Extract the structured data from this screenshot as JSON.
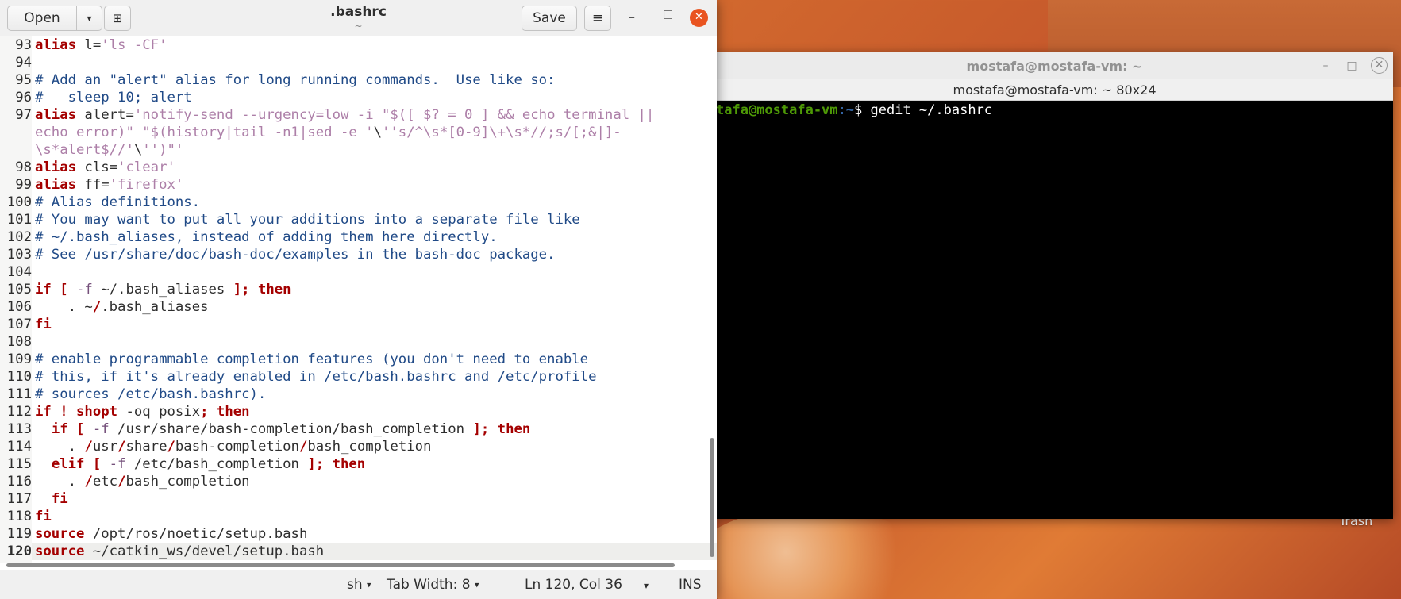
{
  "desktop": {
    "trash_label": "Trash"
  },
  "terminal": {
    "title": "mostafa@mostafa-vm: ~",
    "size_label": "mostafa@mostafa-vm: ~ 80x24",
    "prompt_user": "tafa@mostafa-vm",
    "prompt_path": ":~",
    "prompt_symbol": "$ ",
    "command": "gedit ~/.bashrc",
    "controls": {
      "minimize": "–",
      "maximize": "□",
      "close": "✕"
    }
  },
  "gedit": {
    "open_label": "Open",
    "open_arrow": "▾",
    "new_tab_icon": "⊞",
    "save_label": "Save",
    "menu_icon": "≡",
    "title": ".bashrc",
    "subtitle": "~",
    "controls": {
      "minimize": "–",
      "maximize": "□",
      "close": "✕"
    },
    "status": {
      "language": "sh",
      "tab_width": "Tab Width: 8",
      "position": "Ln 120, Col 36",
      "mode": "INS"
    },
    "lines": [
      {
        "n": "93",
        "html": "<span class=\"kw\">alias</span> l=<span class=\"str\">'ls -CF'</span>"
      },
      {
        "n": "94",
        "html": ""
      },
      {
        "n": "95",
        "html": "<span class=\"cm\"># Add an \"alert\" alias for long running commands.  Use like so:</span>"
      },
      {
        "n": "96",
        "html": "<span class=\"cm\">#   sleep 10; alert</span>"
      },
      {
        "n": "97",
        "html": "<span class=\"kw\">alias</span> alert=<span class=\"str\">'notify-send --urgency=low -i \"$([ $? = 0 ] &amp;&amp; echo terminal ||</span>"
      },
      {
        "n": "",
        "html": "<span class=\"str\">echo error)\" \"$(history|tail -n1|sed -e '</span>\\<span class=\"str\">''s/^\\s*[0-9]\\+\\s*//;s/[;&amp;|]-</span>"
      },
      {
        "n": "",
        "html": "<span class=\"str\">\\s*alert$//'</span>\\<span class=\"str\">'')\"'</span>"
      },
      {
        "n": "98",
        "html": "<span class=\"kw\">alias</span> cls=<span class=\"str\">'clear'</span>"
      },
      {
        "n": "99",
        "html": "<span class=\"kw\">alias</span> ff=<span class=\"str\">'firefox'</span>"
      },
      {
        "n": "100",
        "html": "<span class=\"cm\"># Alias definitions.</span>"
      },
      {
        "n": "101",
        "html": "<span class=\"cm\"># You may want to put all your additions into a separate file like</span>"
      },
      {
        "n": "102",
        "html": "<span class=\"cm\"># ~/.bash_aliases, instead of adding them here directly.</span>"
      },
      {
        "n": "103",
        "html": "<span class=\"cm\"># See /usr/share/doc/bash-doc/examples in the bash-doc package.</span>"
      },
      {
        "n": "104",
        "html": ""
      },
      {
        "n": "105",
        "html": "<span class=\"kw\">if</span> <span class=\"op\">[</span> <span class=\"opt\">-f</span> ~/.bash_aliases <span class=\"op\">];</span> <span class=\"kw\">then</span>"
      },
      {
        "n": "106",
        "html": "    . ~<span class=\"op\">/</span>.bash_aliases"
      },
      {
        "n": "107",
        "html": "<span class=\"kw\">fi</span>"
      },
      {
        "n": "108",
        "html": ""
      },
      {
        "n": "109",
        "html": "<span class=\"cm\"># enable programmable completion features (you don't need to enable</span>"
      },
      {
        "n": "110",
        "html": "<span class=\"cm\"># this, if it's already enabled in /etc/bash.bashrc and /etc/profile</span>"
      },
      {
        "n": "111",
        "html": "<span class=\"cm\"># sources /etc/bash.bashrc).</span>"
      },
      {
        "n": "112",
        "html": "<span class=\"kw\">if</span> <span class=\"op\">!</span> <span class=\"kw\">shopt</span> -oq posix<span class=\"op\">;</span> <span class=\"kw\">then</span>"
      },
      {
        "n": "113",
        "html": "  <span class=\"kw\">if</span> <span class=\"op\">[</span> <span class=\"opt\">-f</span> /usr/share/bash-completion/bash_completion <span class=\"op\">];</span> <span class=\"kw\">then</span>"
      },
      {
        "n": "114",
        "html": "    . <span class=\"op\">/</span>usr<span class=\"op\">/</span>share<span class=\"op\">/</span>bash-completion<span class=\"op\">/</span>bash_completion"
      },
      {
        "n": "115",
        "html": "  <span class=\"kw\">elif</span> <span class=\"op\">[</span> <span class=\"opt\">-f</span> /etc/bash_completion <span class=\"op\">];</span> <span class=\"kw\">then</span>"
      },
      {
        "n": "116",
        "html": "    . <span class=\"op\">/</span>etc<span class=\"op\">/</span>bash_completion"
      },
      {
        "n": "117",
        "html": "  <span class=\"kw\">fi</span>"
      },
      {
        "n": "118",
        "html": "<span class=\"kw\">fi</span>"
      },
      {
        "n": "119",
        "html": "<span class=\"kw\">source</span> /opt/ros/noetic/setup.bash"
      },
      {
        "n": "120",
        "html": "<span class=\"kw\">source</span> ~/catkin_ws/devel/setup.bash",
        "current": true
      }
    ]
  }
}
